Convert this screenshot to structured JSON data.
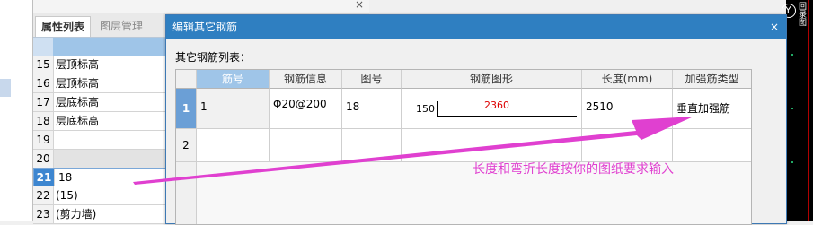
{
  "prop_panel": {
    "close_glyph": "×",
    "tabs": [
      "属性列表",
      "图层管理"
    ],
    "rows": [
      {
        "num": "15",
        "value": "层顶标高"
      },
      {
        "num": "16",
        "value": "层顶标高"
      },
      {
        "num": "17",
        "value": "层底标高"
      },
      {
        "num": "18",
        "value": "层底标高"
      },
      {
        "num": "19",
        "value": ""
      },
      {
        "num": "20",
        "value": ""
      },
      {
        "num": "21",
        "value": "18"
      },
      {
        "num": "22",
        "value": "(15)"
      },
      {
        "num": "23",
        "value": "(剪力墙)"
      }
    ]
  },
  "dialog": {
    "title": "编辑其它钢筋",
    "close_glyph": "×",
    "list_label": "其它钢筋列表：",
    "columns": [
      "筋号",
      "钢筋信息",
      "图号",
      "钢筋图形",
      "长度(mm)",
      "加强筋类型"
    ],
    "rows": [
      {
        "num": "1",
        "bar_no": "1",
        "info": "Φ20@200",
        "fig_no": "18",
        "shape_left": "150",
        "shape_mid": "2360",
        "length": "2510",
        "type": "垂直加强筋"
      },
      {
        "num": "2",
        "bar_no": "",
        "info": "",
        "fig_no": "",
        "shape_left": "",
        "shape_mid": "",
        "length": "",
        "type": ""
      }
    ]
  },
  "canvas": {
    "axis_label": "Y",
    "vertical_text": "回录图"
  },
  "annotation": {
    "text": "长度和弯折长度按你的图纸要求输入",
    "color": "#e040d0"
  }
}
